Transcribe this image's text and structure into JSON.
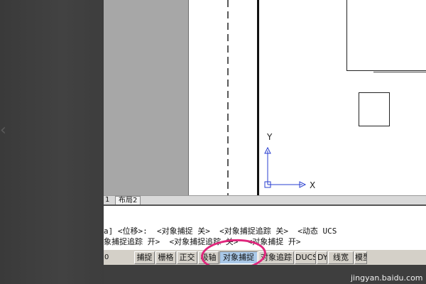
{
  "canvas": {
    "ucs_x_label": "X",
    "ucs_y_label": "Y"
  },
  "tabs": {
    "layout1": "1",
    "layout2": "布局2"
  },
  "command": {
    "line1": "a] <位移>:  <对象捕捉 关>  <对象捕捉追踪 关>  <动态 UCS",
    "line2": "象捕捉追踪 开>  <对象捕捉追踪 关>  <对象捕捉 开>"
  },
  "status_bar": {
    "coords": "0",
    "buttons": [
      {
        "label": "捕捉",
        "active": false
      },
      {
        "label": "栅格",
        "active": false
      },
      {
        "label": "正交",
        "active": false
      },
      {
        "label": "极轴",
        "active": false
      },
      {
        "label": "对象捕捉",
        "active": true
      },
      {
        "label": "对象追踪",
        "active": false
      },
      {
        "label": "DUCS",
        "active": false
      },
      {
        "label": "DYN",
        "active": false
      },
      {
        "label": "线宽",
        "active": false
      },
      {
        "label": "模型",
        "active": false
      }
    ]
  },
  "colors": {
    "highlight": "#e0267c",
    "active_button": "#a9c8e8"
  },
  "watermark": "jingyan.baidu.com"
}
